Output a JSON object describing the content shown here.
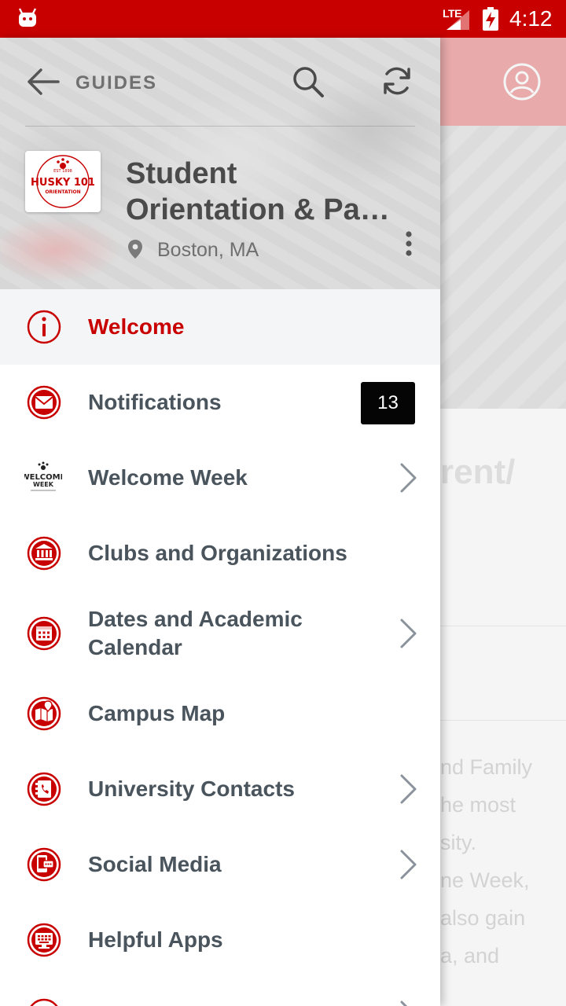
{
  "status_bar": {
    "network": "LTE",
    "time": "4:12"
  },
  "background": {
    "title_fragment": "rent/",
    "body_lines": [
      "nd Family",
      "he most",
      "sity.",
      "ne Week,",
      "also gain",
      "a, and"
    ]
  },
  "header": {
    "back_label": "GUIDES",
    "logo": {
      "line1": "EST 1898",
      "line2": "HUSKY 101",
      "line3": "ORIENTATION"
    },
    "title_line1": "Student",
    "title_line2": "Orientation & Pa…",
    "location": "Boston, MA"
  },
  "menu": {
    "items": [
      {
        "label": "Welcome",
        "icon": "info-icon",
        "active": true
      },
      {
        "label": "Notifications",
        "icon": "envelope-icon",
        "badge": "13"
      },
      {
        "label": "Welcome Week",
        "icon": "welcome-week-logo-icon",
        "chevron": true,
        "icon_text_1": "WELCOME",
        "icon_text_2": "WEEK"
      },
      {
        "label": "Clubs and Organizations",
        "icon": "institution-icon"
      },
      {
        "label": "Dates and Academic Calendar",
        "icon": "calendar-icon",
        "chevron": true
      },
      {
        "label": "Campus Map",
        "icon": "map-icon"
      },
      {
        "label": "University Contacts",
        "icon": "contacts-icon",
        "chevron": true
      },
      {
        "label": "Social Media",
        "icon": "social-media-icon",
        "chevron": true
      },
      {
        "label": "Helpful Apps",
        "icon": "apps-icon"
      }
    ]
  },
  "colors": {
    "accent": "#c80000",
    "status_bar": "#c80000",
    "menu_text": "#4a545c",
    "active_row": "#f4f5f7",
    "badge": "#050505"
  }
}
